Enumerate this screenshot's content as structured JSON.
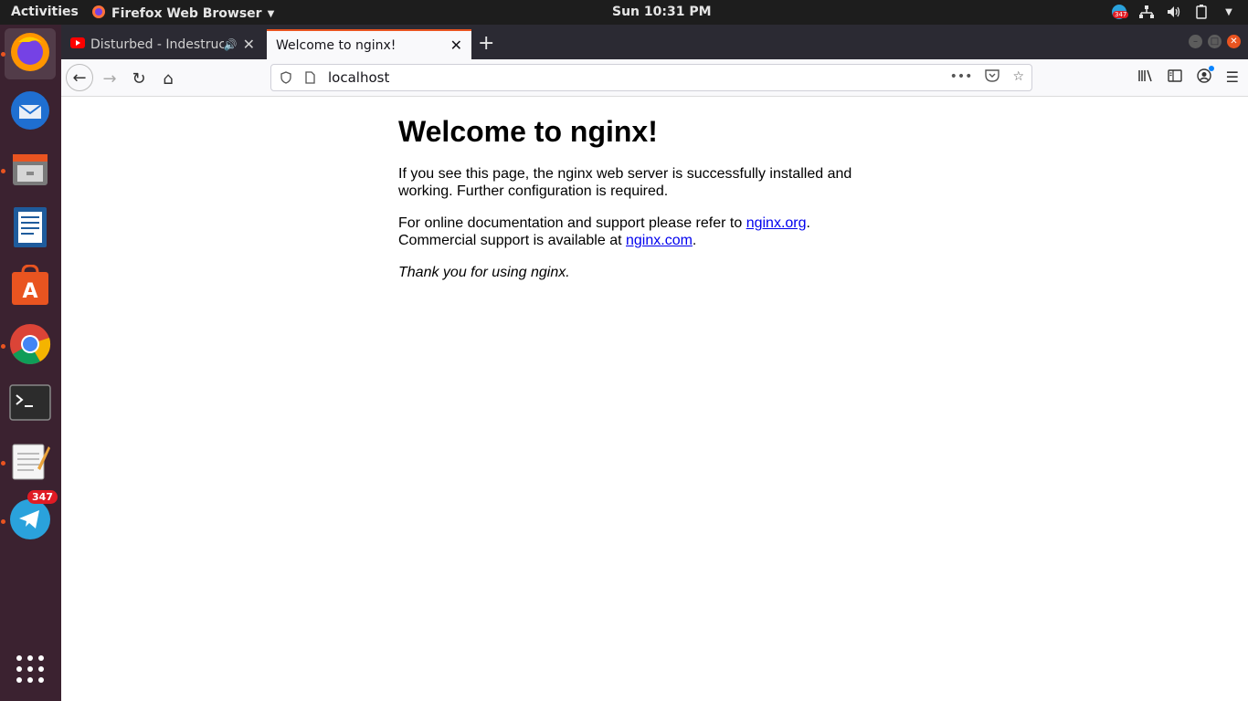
{
  "topbar": {
    "activities": "Activities",
    "app_name": "Firefox Web Browser",
    "clock": "Sun 10:31 PM",
    "tray_badge": "347"
  },
  "dock": {
    "items": [
      {
        "name": "firefox",
        "active": true
      },
      {
        "name": "thunderbird"
      },
      {
        "name": "files"
      },
      {
        "name": "writer"
      },
      {
        "name": "software"
      },
      {
        "name": "chrome"
      },
      {
        "name": "terminal"
      },
      {
        "name": "text-editor"
      },
      {
        "name": "telegram",
        "badge": "347"
      }
    ]
  },
  "browser": {
    "tabs": [
      {
        "title": "Disturbed - Indestruct",
        "active": false
      },
      {
        "title": "Welcome to nginx!",
        "active": true
      }
    ],
    "url": "localhost"
  },
  "page": {
    "heading": "Welcome to nginx!",
    "p1": "If you see this page, the nginx web server is successfully installed and working. Further configuration is required.",
    "p2_before": "For online documentation and support please refer to ",
    "link1": "nginx.org",
    "p2_middle": ". Commercial support is available at ",
    "link2": "nginx.com",
    "p2_end": ".",
    "p3": "Thank you for using nginx."
  },
  "colors": {
    "accent": "#e95420",
    "dock_bg": "#3b2230",
    "link": "#0000ee"
  }
}
